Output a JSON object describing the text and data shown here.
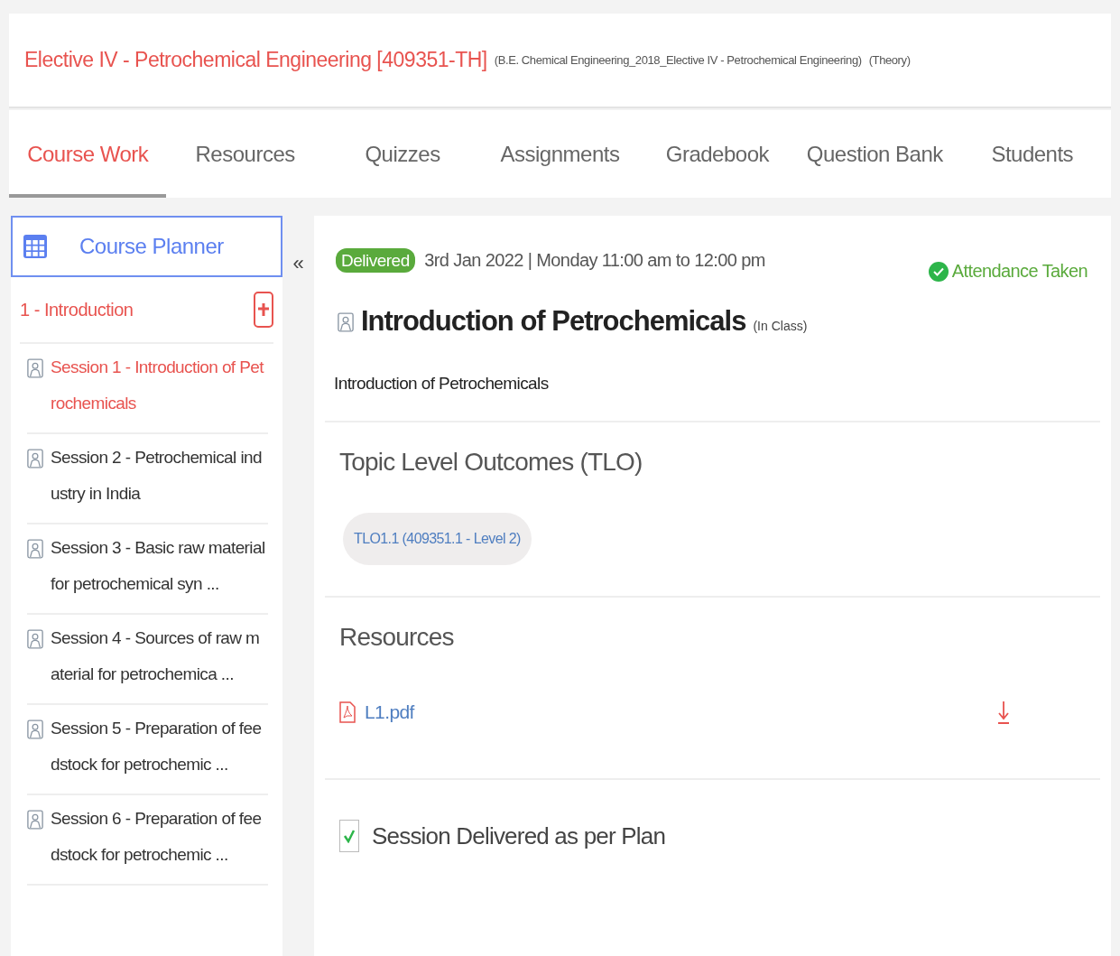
{
  "course": {
    "title": "Elective IV - Petrochemical Engineering [409351-TH]",
    "subtitle": "(B.E. Chemical Engineering_2018_Elective IV - Petrochemical Engineering)",
    "type": "(Theory)"
  },
  "tabs": [
    {
      "label": "Course Work",
      "selected": true
    },
    {
      "label": "Resources",
      "selected": false
    },
    {
      "label": "Quizzes",
      "selected": false
    },
    {
      "label": "Assignments",
      "selected": false
    },
    {
      "label": "Gradebook",
      "selected": false
    },
    {
      "label": "Question Bank",
      "selected": false
    },
    {
      "label": "Students",
      "selected": false
    }
  ],
  "sidebar": {
    "title": "Course Planner",
    "collapse": "«",
    "unit": "1 - Introduction",
    "sessions": [
      {
        "label": "Session 1 - Introduction of Petrochemicals",
        "selected": true
      },
      {
        "label": "Session 2 - Petrochemical industry in India",
        "selected": false
      },
      {
        "label": "Session 3 - Basic raw material for petrochemical syn ...",
        "selected": false
      },
      {
        "label": "Session 4 - Sources of raw material for petrochemica ...",
        "selected": false
      },
      {
        "label": "Session 5 - Preparation of feedstock for petrochemic ...",
        "selected": false
      },
      {
        "label": "Session 6 - Preparation of feedstock for petrochemic ...",
        "selected": false
      }
    ]
  },
  "session": {
    "status": "Delivered",
    "schedule": "3rd Jan 2022 | Monday 11:00 am to 12:00 pm",
    "attendance": "Attendance Taken",
    "title": "Introduction of Petrochemicals",
    "mode": "(In Class)",
    "description": "Introduction of Petrochemicals",
    "tlo_heading": "Topic Level Outcomes (TLO)",
    "tlos": [
      "TLO1.1 (409351.1 - Level 2)"
    ],
    "resources_heading": "Resources",
    "files": [
      "L1.pdf"
    ],
    "delivered_check": {
      "label": "Session Delivered as per Plan",
      "checked": true
    }
  }
}
